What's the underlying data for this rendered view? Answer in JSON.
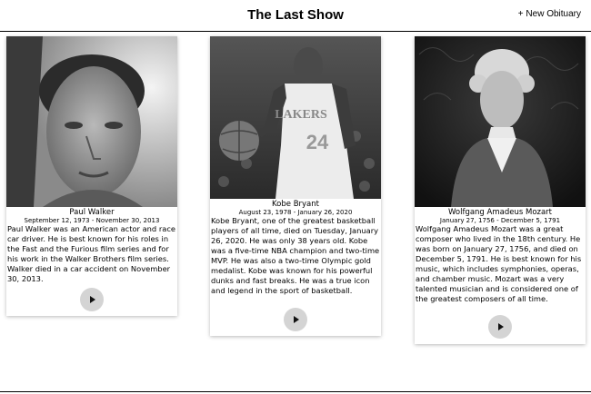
{
  "header": {
    "title": "The Last Show",
    "new_button": "+ New Obituary"
  },
  "obituaries": [
    {
      "name": "Paul Walker",
      "dates": "September 12, 1973 - November 30, 2013",
      "description": "Paul Walker was an American actor and race car driver. He is best known for his roles in the Fast and the Furious film series and for his work in the Walker Brothers film series. Walker died in a car accident on November 30, 2013.",
      "photo": "portrait-photo"
    },
    {
      "name": "Kobe Bryant",
      "dates": "August 23, 1978 - January 26, 2020",
      "description": "Kobe Bryant, one of the greatest basketball players of all time, died on Tuesday, January 26, 2020. He was only 38 years old. Kobe was a five-time NBA champion and two-time MVP. He was also a two-time Olympic gold medalist. Kobe was known for his powerful dunks and fast breaks. He was a true icon and legend in the sport of basketball.",
      "photo": "portrait-photo"
    },
    {
      "name": "Wolfgang Amadeus Mozart",
      "dates": "January 27, 1756 - December 5, 1791",
      "description": "Wolfgang Amadeus Mozart was a great composer who lived in the 18th century. He was born on January 27, 1756, and died on December 5, 1791. He is best known for his music, which includes symphonies, operas, and chamber music. Mozart was a very talented musician and is considered one of the greatest composers of all time.",
      "photo": "portrait-photo"
    }
  ],
  "icons": {
    "play": "play-icon"
  }
}
